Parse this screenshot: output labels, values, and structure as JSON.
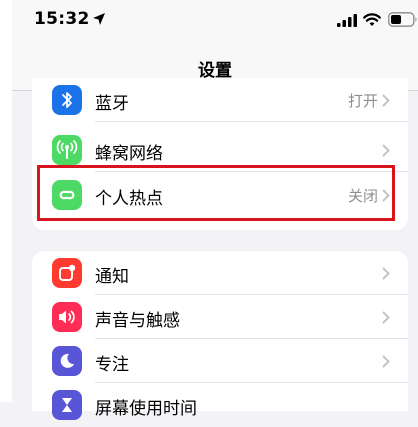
{
  "status_bar": {
    "time": "15:32"
  },
  "nav": {
    "title": "设置"
  },
  "groups": [
    {
      "items": [
        {
          "label": "蓝牙",
          "value": "打开",
          "icon": "bluetooth-icon",
          "color": "#1a73e8"
        },
        {
          "label": "蜂窝网络",
          "value": "",
          "icon": "cellular-antenna-icon",
          "color": "#4cd964"
        },
        {
          "label": "个人热点",
          "value": "关闭",
          "icon": "personal-hotspot-icon",
          "color": "#4cd964"
        }
      ]
    },
    {
      "items": [
        {
          "label": "通知",
          "value": "",
          "icon": "notifications-icon",
          "color": "#ff3b30"
        },
        {
          "label": "声音与触感",
          "value": "",
          "icon": "sound-speaker-icon",
          "color": "#ff2d55"
        },
        {
          "label": "专注",
          "value": "",
          "icon": "moon-icon",
          "color": "#5856d6"
        },
        {
          "label": "屏幕使用时间",
          "value": "",
          "icon": "hourglass-icon",
          "color": "#5856d6"
        }
      ]
    }
  ],
  "highlight": {
    "color": "#d9141e",
    "target": "个人热点"
  }
}
